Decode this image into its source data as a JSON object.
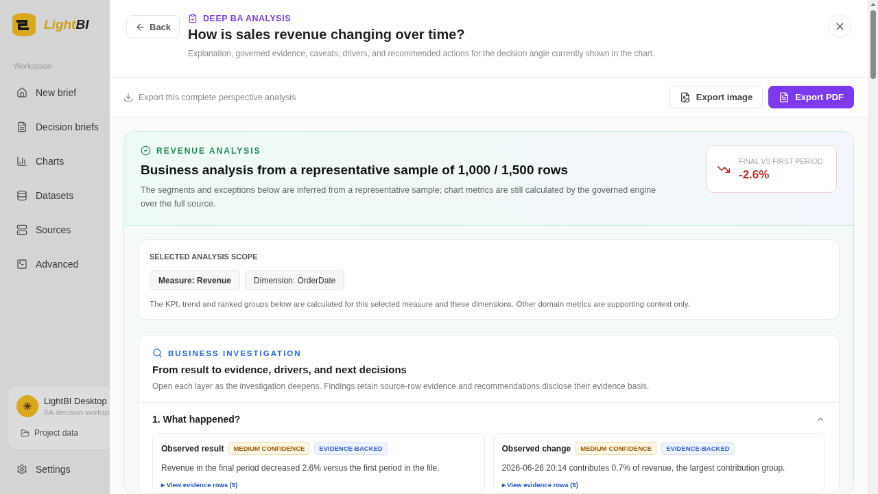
{
  "sidebar": {
    "brand_light": "Light",
    "brand_bold": "BI",
    "section": "Workspace",
    "items": [
      {
        "label": "New brief"
      },
      {
        "label": "Decision briefs"
      },
      {
        "label": "Charts"
      },
      {
        "label": "Datasets"
      },
      {
        "label": "Sources"
      },
      {
        "label": "Advanced"
      }
    ],
    "workspace": {
      "name": "LightBI Desktop",
      "subtitle": "BA decision worksp",
      "link": "Project data"
    },
    "settings": "Settings"
  },
  "header": {
    "back": "Back",
    "eyebrow": "DEEP BA ANALYSIS",
    "title": "How is sales revenue changing over time?",
    "subtitle": "Explanation, governed evidence, caveats, drivers, and recommended actions for the decision angle currently shown in the chart."
  },
  "export_bar": {
    "hint": "Export this complete perspective analysis",
    "buttons": [
      {
        "label": "Export image",
        "kind": "secondary"
      },
      {
        "label": "Export PDF",
        "kind": "primary"
      }
    ]
  },
  "analysis": {
    "eyebrow": "REVENUE ANALYSIS",
    "title": "Business analysis from a representative sample of 1,000 / 1,500 rows",
    "description": "The segments and exceptions below are inferred from a representative sample; chart metrics are still calculated by the governed engine over the full source.",
    "kpi": {
      "label": "FINAL VS FIRST PERIOD",
      "value": "-2.6%"
    }
  },
  "scope": {
    "title": "SELECTED ANALYSIS SCOPE",
    "chips": [
      {
        "label": "Measure: Revenue",
        "selected": true
      },
      {
        "label": "Dimension: OrderDate",
        "selected": false
      }
    ],
    "note": "The KPI, trend and ranked groups below are calculated for this selected measure and these dimensions. Other domain metrics are supporting context only."
  },
  "investigation": {
    "eyebrow": "BUSINESS INVESTIGATION",
    "title": "From result to evidence, drivers, and next decisions",
    "description": "Open each layer as the investigation deepens. Findings retain source-row evidence and recommendations disclose their evidence basis.",
    "sections": [
      {
        "title": "1. What happened?",
        "expanded": true,
        "findings": [
          {
            "title": "Observed result",
            "tags": [
              {
                "label": "MEDIUM CONFIDENCE",
                "kind": "confidence"
              },
              {
                "label": "EVIDENCE-BACKED",
                "kind": "evidence"
              }
            ],
            "text": "Revenue in the final period decreased 2.6% versus the first period in the file.",
            "link": "▸ View evidence rows (5)"
          },
          {
            "title": "Observed change",
            "tags": [
              {
                "label": "MEDIUM CONFIDENCE",
                "kind": "confidence"
              },
              {
                "label": "EVIDENCE-BACKED",
                "kind": "evidence"
              }
            ],
            "text": "2026-06-26 20:14 contributes 0.7% of revenue, the largest contribution group.",
            "link": "▸ View evidence rows (5)"
          }
        ]
      }
    ]
  }
}
